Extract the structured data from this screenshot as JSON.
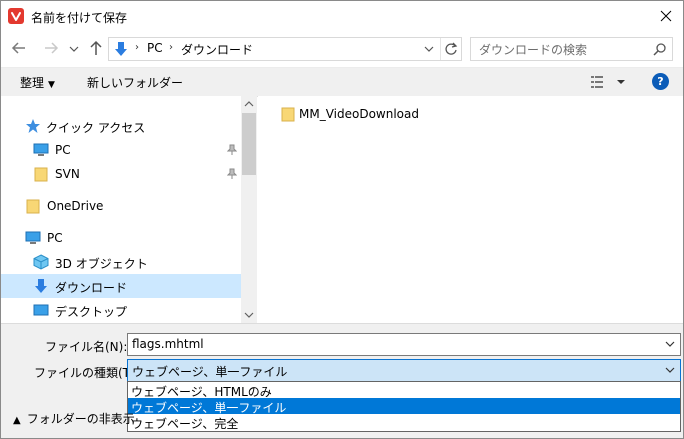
{
  "window": {
    "title": "名前を付けて保存"
  },
  "address": {
    "crumbs": [
      "PC",
      "ダウンロード"
    ]
  },
  "search": {
    "placeholder": "ダウンロードの検索"
  },
  "toolbar": {
    "organize": "整理",
    "new_folder": "新しいフォルダー"
  },
  "help_label": "?",
  "nav": {
    "quick_access": "クイック アクセス",
    "pc_pinned": "PC",
    "svn": "SVN",
    "onedrive": "OneDrive",
    "pc": "PC",
    "objects3d": "3D オブジェクト",
    "downloads": "ダウンロード",
    "desktop": "デスクトップ"
  },
  "content": {
    "items": [
      "MM_VideoDownload"
    ]
  },
  "bottom": {
    "filename_label": "ファイル名(N):",
    "filename_value": "flags.mhtml",
    "filetype_label": "ファイルの種類(T):",
    "filetype_value": "ウェブページ、単一ファイル",
    "filetype_options": [
      "ウェブページ、HTMLのみ",
      "ウェブページ、単一ファイル",
      "ウェブページ、完全"
    ],
    "hide_folders": "フォルダーの非表示"
  },
  "colors": {
    "accent": "#0078d7",
    "selected_nav": "#cce8ff",
    "folder": "#f8d775",
    "vivaldi": "#e3392f"
  }
}
